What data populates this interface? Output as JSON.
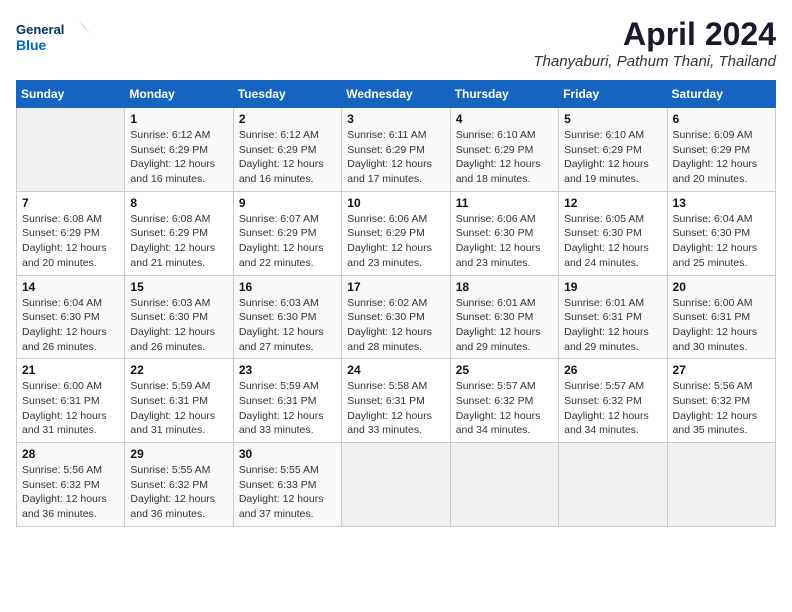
{
  "header": {
    "logo_line1": "General",
    "logo_line2": "Blue",
    "title": "April 2024",
    "subtitle": "Thanyaburi, Pathum Thani, Thailand"
  },
  "days_of_week": [
    "Sunday",
    "Monday",
    "Tuesday",
    "Wednesday",
    "Thursday",
    "Friday",
    "Saturday"
  ],
  "weeks": [
    [
      {
        "day": "",
        "detail": ""
      },
      {
        "day": "1",
        "detail": "Sunrise: 6:12 AM\nSunset: 6:29 PM\nDaylight: 12 hours\nand 16 minutes."
      },
      {
        "day": "2",
        "detail": "Sunrise: 6:12 AM\nSunset: 6:29 PM\nDaylight: 12 hours\nand 16 minutes."
      },
      {
        "day": "3",
        "detail": "Sunrise: 6:11 AM\nSunset: 6:29 PM\nDaylight: 12 hours\nand 17 minutes."
      },
      {
        "day": "4",
        "detail": "Sunrise: 6:10 AM\nSunset: 6:29 PM\nDaylight: 12 hours\nand 18 minutes."
      },
      {
        "day": "5",
        "detail": "Sunrise: 6:10 AM\nSunset: 6:29 PM\nDaylight: 12 hours\nand 19 minutes."
      },
      {
        "day": "6",
        "detail": "Sunrise: 6:09 AM\nSunset: 6:29 PM\nDaylight: 12 hours\nand 20 minutes."
      }
    ],
    [
      {
        "day": "7",
        "detail": "Sunrise: 6:08 AM\nSunset: 6:29 PM\nDaylight: 12 hours\nand 20 minutes."
      },
      {
        "day": "8",
        "detail": "Sunrise: 6:08 AM\nSunset: 6:29 PM\nDaylight: 12 hours\nand 21 minutes."
      },
      {
        "day": "9",
        "detail": "Sunrise: 6:07 AM\nSunset: 6:29 PM\nDaylight: 12 hours\nand 22 minutes."
      },
      {
        "day": "10",
        "detail": "Sunrise: 6:06 AM\nSunset: 6:29 PM\nDaylight: 12 hours\nand 23 minutes."
      },
      {
        "day": "11",
        "detail": "Sunrise: 6:06 AM\nSunset: 6:30 PM\nDaylight: 12 hours\nand 23 minutes."
      },
      {
        "day": "12",
        "detail": "Sunrise: 6:05 AM\nSunset: 6:30 PM\nDaylight: 12 hours\nand 24 minutes."
      },
      {
        "day": "13",
        "detail": "Sunrise: 6:04 AM\nSunset: 6:30 PM\nDaylight: 12 hours\nand 25 minutes."
      }
    ],
    [
      {
        "day": "14",
        "detail": "Sunrise: 6:04 AM\nSunset: 6:30 PM\nDaylight: 12 hours\nand 26 minutes."
      },
      {
        "day": "15",
        "detail": "Sunrise: 6:03 AM\nSunset: 6:30 PM\nDaylight: 12 hours\nand 26 minutes."
      },
      {
        "day": "16",
        "detail": "Sunrise: 6:03 AM\nSunset: 6:30 PM\nDaylight: 12 hours\nand 27 minutes."
      },
      {
        "day": "17",
        "detail": "Sunrise: 6:02 AM\nSunset: 6:30 PM\nDaylight: 12 hours\nand 28 minutes."
      },
      {
        "day": "18",
        "detail": "Sunrise: 6:01 AM\nSunset: 6:30 PM\nDaylight: 12 hours\nand 29 minutes."
      },
      {
        "day": "19",
        "detail": "Sunrise: 6:01 AM\nSunset: 6:31 PM\nDaylight: 12 hours\nand 29 minutes."
      },
      {
        "day": "20",
        "detail": "Sunrise: 6:00 AM\nSunset: 6:31 PM\nDaylight: 12 hours\nand 30 minutes."
      }
    ],
    [
      {
        "day": "21",
        "detail": "Sunrise: 6:00 AM\nSunset: 6:31 PM\nDaylight: 12 hours\nand 31 minutes."
      },
      {
        "day": "22",
        "detail": "Sunrise: 5:59 AM\nSunset: 6:31 PM\nDaylight: 12 hours\nand 31 minutes."
      },
      {
        "day": "23",
        "detail": "Sunrise: 5:59 AM\nSunset: 6:31 PM\nDaylight: 12 hours\nand 33 minutes."
      },
      {
        "day": "24",
        "detail": "Sunrise: 5:58 AM\nSunset: 6:31 PM\nDaylight: 12 hours\nand 33 minutes."
      },
      {
        "day": "25",
        "detail": "Sunrise: 5:57 AM\nSunset: 6:32 PM\nDaylight: 12 hours\nand 34 minutes."
      },
      {
        "day": "26",
        "detail": "Sunrise: 5:57 AM\nSunset: 6:32 PM\nDaylight: 12 hours\nand 34 minutes."
      },
      {
        "day": "27",
        "detail": "Sunrise: 5:56 AM\nSunset: 6:32 PM\nDaylight: 12 hours\nand 35 minutes."
      }
    ],
    [
      {
        "day": "28",
        "detail": "Sunrise: 5:56 AM\nSunset: 6:32 PM\nDaylight: 12 hours\nand 36 minutes."
      },
      {
        "day": "29",
        "detail": "Sunrise: 5:55 AM\nSunset: 6:32 PM\nDaylight: 12 hours\nand 36 minutes."
      },
      {
        "day": "30",
        "detail": "Sunrise: 5:55 AM\nSunset: 6:33 PM\nDaylight: 12 hours\nand 37 minutes."
      },
      {
        "day": "",
        "detail": ""
      },
      {
        "day": "",
        "detail": ""
      },
      {
        "day": "",
        "detail": ""
      },
      {
        "day": "",
        "detail": ""
      }
    ]
  ]
}
